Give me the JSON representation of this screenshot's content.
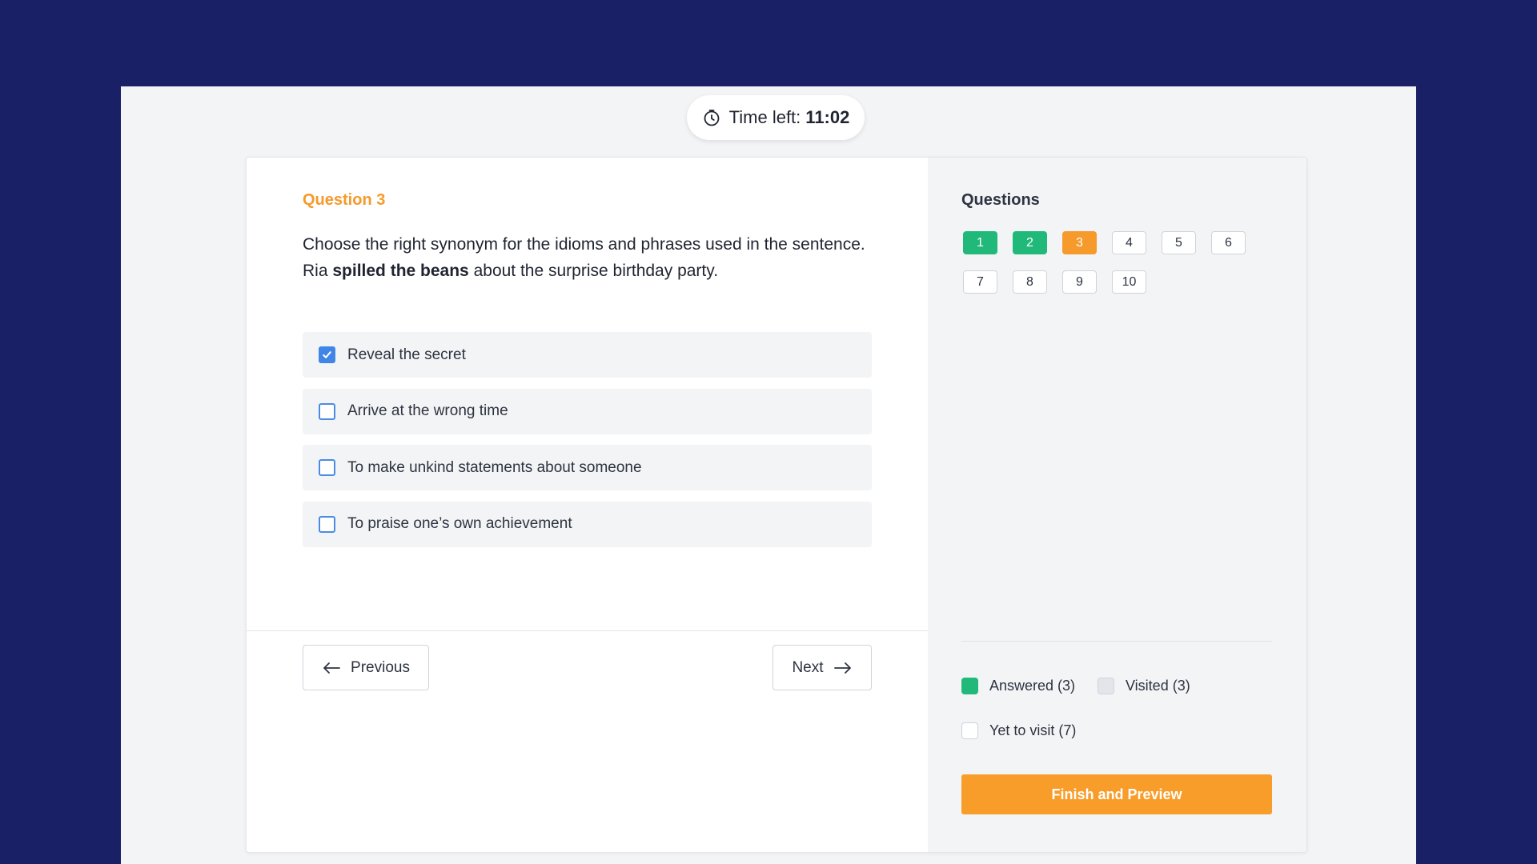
{
  "timer": {
    "label": "Time left:",
    "value": "11:02",
    "icon": "clock-icon"
  },
  "question": {
    "number_label": "Question 3",
    "prompt": "Choose the right synonym for the idioms and phrases used in the sentence.",
    "sentence_prefix": "Ria ",
    "sentence_emphasis": "spilled the beans",
    "sentence_suffix": " about the surprise birthday party.",
    "options": [
      {
        "label": "Reveal the secret",
        "checked": true
      },
      {
        "label": "Arrive at the wrong time",
        "checked": false
      },
      {
        "label": "To make unkind statements about someone",
        "checked": false
      },
      {
        "label": "To praise one’s own achievement",
        "checked": false
      }
    ]
  },
  "navigation": {
    "previous_label": "Previous",
    "next_label": "Next",
    "previous_icon": "arrow-left-icon",
    "next_icon": "arrow-right-icon"
  },
  "sidebar": {
    "title": "Questions",
    "questions": [
      {
        "label": "1",
        "status": "answered"
      },
      {
        "label": "2",
        "status": "answered"
      },
      {
        "label": "3",
        "status": "current"
      },
      {
        "label": "4",
        "status": "unvisited"
      },
      {
        "label": "5",
        "status": "unvisited"
      },
      {
        "label": "6",
        "status": "unvisited"
      },
      {
        "label": "7",
        "status": "unvisited"
      },
      {
        "label": "8",
        "status": "unvisited"
      },
      {
        "label": "9",
        "status": "unvisited"
      },
      {
        "label": "10",
        "status": "unvisited"
      }
    ],
    "legend": {
      "answered": "Answered (3)",
      "visited": "Visited (3)",
      "yet_to_visit": "Yet to visit (7)"
    },
    "finish_label": "Finish and Preview"
  },
  "colors": {
    "page_background": "#1a2066",
    "accent_orange": "#f59a2b",
    "answered_green": "#20b97a",
    "checkbox_blue": "#3f86e6"
  }
}
